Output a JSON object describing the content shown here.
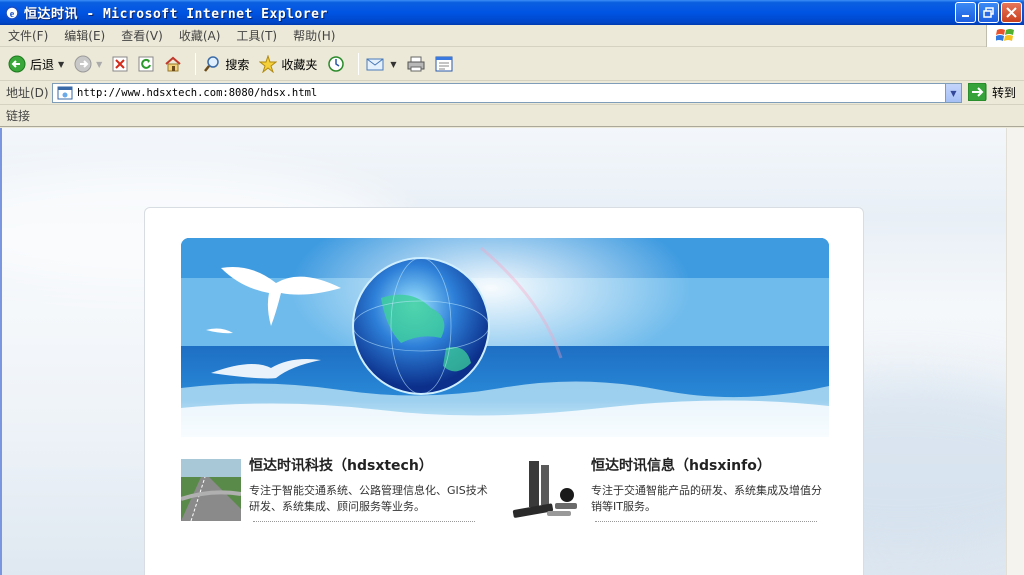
{
  "window": {
    "title": "恒达时讯 - Microsoft Internet Explorer"
  },
  "menu": {
    "items": [
      "文件(F)",
      "编辑(E)",
      "查看(V)",
      "收藏(A)",
      "工具(T)",
      "帮助(H)"
    ]
  },
  "toolbar": {
    "back_label": "后退",
    "search_label": "搜索",
    "favorites_label": "收藏夹"
  },
  "address": {
    "label": "地址(D)",
    "url": "http://www.hdsxtech.com:8080/hdsx.html",
    "go_label": "转到"
  },
  "links": {
    "label": "链接"
  },
  "page": {
    "sections": [
      {
        "title": "恒达时讯科技（hdsxtech）",
        "desc": "专注于智能交通系统、公路管理信息化、GIS技术研发、系统集成、顾问服务等业务。"
      },
      {
        "title": "恒达时讯信息（hdsxinfo）",
        "desc": "专注于交通智能产品的研发、系统集成及增值分销等IT服务。"
      }
    ]
  }
}
